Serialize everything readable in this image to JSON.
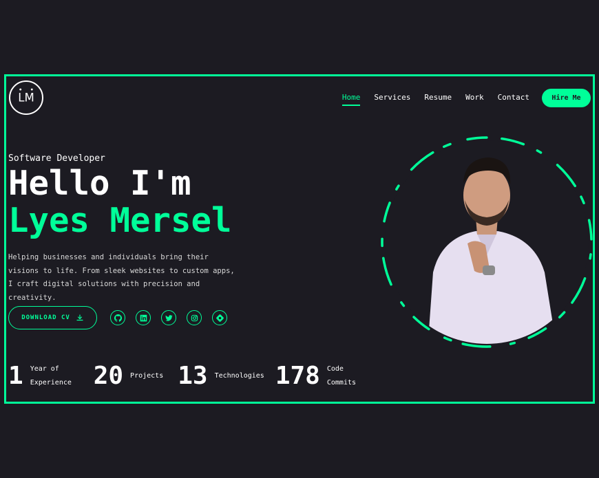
{
  "logo": {
    "text": "LM"
  },
  "nav": {
    "items": [
      {
        "label": "Home",
        "active": true
      },
      {
        "label": "Services",
        "active": false
      },
      {
        "label": "Resume",
        "active": false
      },
      {
        "label": "Work",
        "active": false
      },
      {
        "label": "Contact",
        "active": false
      }
    ],
    "hire_label": "Hire Me"
  },
  "hero": {
    "role": "Software Developer",
    "greeting": "Hello I'm",
    "name": "Lyes Mersel",
    "description": "Helping businesses and individuals bring their visions to life. From sleek websites to custom apps, I craft digital solutions with precision and creativity.",
    "cv_label": "DOWNLOAD CV"
  },
  "socials": [
    {
      "icon": "github-icon"
    },
    {
      "icon": "linkedin-icon"
    },
    {
      "icon": "twitter-icon"
    },
    {
      "icon": "instagram-icon"
    },
    {
      "icon": "hashnode-icon"
    }
  ],
  "stats": [
    {
      "number": "1",
      "label": "Year of Experience"
    },
    {
      "number": "20",
      "label": "Projects"
    },
    {
      "number": "13",
      "label": "Technologies"
    },
    {
      "number": "178",
      "label": "Code Commits"
    }
  ],
  "colors": {
    "accent": "#00ff99",
    "background": "#1c1b22",
    "text": "#ffffff"
  }
}
